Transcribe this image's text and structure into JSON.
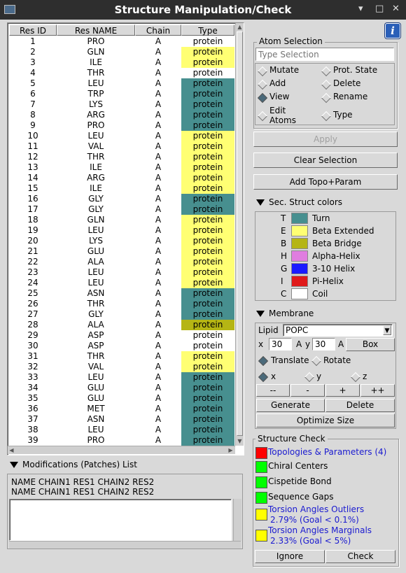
{
  "window": {
    "title": "Structure Manipulation/Check",
    "min": "▾",
    "max": "□",
    "close": "✕"
  },
  "table": {
    "headers": [
      "Res ID",
      "Res NAME",
      "Chain",
      "Type"
    ],
    "rows": [
      {
        "id": "1",
        "name": "PRO",
        "chain": "A",
        "type": "protein",
        "color": "#ffffff"
      },
      {
        "id": "2",
        "name": "GLN",
        "chain": "A",
        "type": "protein",
        "color": "#ffff73"
      },
      {
        "id": "3",
        "name": "ILE",
        "chain": "A",
        "type": "protein",
        "color": "#ffff73"
      },
      {
        "id": "4",
        "name": "THR",
        "chain": "A",
        "type": "protein",
        "color": "#ffffff"
      },
      {
        "id": "5",
        "name": "LEU",
        "chain": "A",
        "type": "protein",
        "color": "#478f8f"
      },
      {
        "id": "6",
        "name": "TRP",
        "chain": "A",
        "type": "protein",
        "color": "#478f8f"
      },
      {
        "id": "7",
        "name": "LYS",
        "chain": "A",
        "type": "protein",
        "color": "#478f8f"
      },
      {
        "id": "8",
        "name": "ARG",
        "chain": "A",
        "type": "protein",
        "color": "#478f8f"
      },
      {
        "id": "9",
        "name": "PRO",
        "chain": "A",
        "type": "protein",
        "color": "#478f8f"
      },
      {
        "id": "10",
        "name": "LEU",
        "chain": "A",
        "type": "protein",
        "color": "#ffff73"
      },
      {
        "id": "11",
        "name": "VAL",
        "chain": "A",
        "type": "protein",
        "color": "#ffff73"
      },
      {
        "id": "12",
        "name": "THR",
        "chain": "A",
        "type": "protein",
        "color": "#ffff73"
      },
      {
        "id": "13",
        "name": "ILE",
        "chain": "A",
        "type": "protein",
        "color": "#ffff73"
      },
      {
        "id": "14",
        "name": "ARG",
        "chain": "A",
        "type": "protein",
        "color": "#ffff73"
      },
      {
        "id": "15",
        "name": "ILE",
        "chain": "A",
        "type": "protein",
        "color": "#ffff73"
      },
      {
        "id": "16",
        "name": "GLY",
        "chain": "A",
        "type": "protein",
        "color": "#478f8f"
      },
      {
        "id": "17",
        "name": "GLY",
        "chain": "A",
        "type": "protein",
        "color": "#478f8f"
      },
      {
        "id": "18",
        "name": "GLN",
        "chain": "A",
        "type": "protein",
        "color": "#ffff73"
      },
      {
        "id": "19",
        "name": "LEU",
        "chain": "A",
        "type": "protein",
        "color": "#ffff73"
      },
      {
        "id": "20",
        "name": "LYS",
        "chain": "A",
        "type": "protein",
        "color": "#ffff73"
      },
      {
        "id": "21",
        "name": "GLU",
        "chain": "A",
        "type": "protein",
        "color": "#ffff73"
      },
      {
        "id": "22",
        "name": "ALA",
        "chain": "A",
        "type": "protein",
        "color": "#ffff73"
      },
      {
        "id": "23",
        "name": "LEU",
        "chain": "A",
        "type": "protein",
        "color": "#ffff73"
      },
      {
        "id": "24",
        "name": "LEU",
        "chain": "A",
        "type": "protein",
        "color": "#ffff73"
      },
      {
        "id": "25",
        "name": "ASN",
        "chain": "A",
        "type": "protein",
        "color": "#478f8f"
      },
      {
        "id": "26",
        "name": "THR",
        "chain": "A",
        "type": "protein",
        "color": "#478f8f"
      },
      {
        "id": "27",
        "name": "GLY",
        "chain": "A",
        "type": "protein",
        "color": "#478f8f"
      },
      {
        "id": "28",
        "name": "ALA",
        "chain": "A",
        "type": "protein",
        "color": "#b5b514"
      },
      {
        "id": "29",
        "name": "ASP",
        "chain": "A",
        "type": "protein",
        "color": "#ffffff"
      },
      {
        "id": "30",
        "name": "ASP",
        "chain": "A",
        "type": "protein",
        "color": "#ffffff"
      },
      {
        "id": "31",
        "name": "THR",
        "chain": "A",
        "type": "protein",
        "color": "#ffff73"
      },
      {
        "id": "32",
        "name": "VAL",
        "chain": "A",
        "type": "protein",
        "color": "#ffff73"
      },
      {
        "id": "33",
        "name": "LEU",
        "chain": "A",
        "type": "protein",
        "color": "#478f8f"
      },
      {
        "id": "34",
        "name": "GLU",
        "chain": "A",
        "type": "protein",
        "color": "#478f8f"
      },
      {
        "id": "35",
        "name": "GLU",
        "chain": "A",
        "type": "protein",
        "color": "#478f8f"
      },
      {
        "id": "36",
        "name": "MET",
        "chain": "A",
        "type": "protein",
        "color": "#478f8f"
      },
      {
        "id": "37",
        "name": "ASN",
        "chain": "A",
        "type": "protein",
        "color": "#478f8f"
      },
      {
        "id": "38",
        "name": "LEU",
        "chain": "A",
        "type": "protein",
        "color": "#478f8f"
      },
      {
        "id": "39",
        "name": "PRO",
        "chain": "A",
        "type": "protein",
        "color": "#478f8f"
      }
    ]
  },
  "modifications": {
    "title": "Modifications (Patches) List",
    "lines": [
      "NAME CHAIN1 RES1 CHAIN2 RES2",
      "NAME CHAIN1 RES1 CHAIN2 RES2"
    ]
  },
  "info_icon": "i",
  "atom_selection": {
    "title": "Atom Selection",
    "placeholder": "Type Selection",
    "modes": [
      {
        "label": "Mutate",
        "checked": false
      },
      {
        "label": "Prot. State",
        "checked": false
      },
      {
        "label": "Add",
        "checked": false
      },
      {
        "label": "Delete",
        "checked": false
      },
      {
        "label": "View",
        "checked": true
      },
      {
        "label": "Rename",
        "checked": false
      },
      {
        "label": "Edit\nAtoms",
        "checked": false
      },
      {
        "label": "Type",
        "checked": false
      }
    ]
  },
  "buttons": {
    "apply": "Apply",
    "clear": "Clear Selection",
    "add_topo": "Add Topo+Param"
  },
  "sec_struct": {
    "title": "Sec. Struct colors",
    "items": [
      {
        "code": "T",
        "label": "Turn",
        "color": "#478f8f"
      },
      {
        "code": "E",
        "label": "Beta Extended",
        "color": "#ffff73"
      },
      {
        "code": "B",
        "label": "Beta Bridge",
        "color": "#b5b514"
      },
      {
        "code": "H",
        "label": "Alpha-Helix",
        "color": "#e07de0"
      },
      {
        "code": "G",
        "label": "3-10 Helix",
        "color": "#1a1aff"
      },
      {
        "code": "I",
        "label": "Pi-Helix",
        "color": "#e01a1a"
      },
      {
        "code": "C",
        "label": "Coil",
        "color": "#ffffff"
      }
    ]
  },
  "membrane": {
    "title": "Membrane",
    "lipid_label": "Lipid",
    "lipid_value": "POPC",
    "x_label": "x",
    "x_value": "30",
    "a_label": "A",
    "y_label": "y",
    "y_value": "30",
    "a2_label": "A",
    "box_btn": "Box",
    "translate": "Translate",
    "rotate": "Rotate",
    "axes": [
      "x",
      "y",
      "z"
    ],
    "steps": [
      "--",
      "-",
      "+",
      "++"
    ],
    "generate": "Generate",
    "delete": "Delete",
    "optimize": "Optimize Size"
  },
  "structure_check": {
    "title": "Structure Check",
    "items": [
      {
        "label": "Topologies & Parameters (4)",
        "sub": "",
        "status": "#ff0000",
        "link": true
      },
      {
        "label": "Chiral Centers",
        "sub": "",
        "status": "#00ff00",
        "link": false
      },
      {
        "label": "Cispetide Bond",
        "sub": "",
        "status": "#00ff00",
        "link": false
      },
      {
        "label": "Sequence Gaps",
        "sub": "",
        "status": "#00ff00",
        "link": false
      },
      {
        "label": "Torsion Angles Outliers",
        "sub": "2.79% (Goal < 0.1%)",
        "status": "#ffff00",
        "link": true
      },
      {
        "label": "Torsion Angles Marginals",
        "sub": "2.33% (Goal < 5%)",
        "status": "#ffff00",
        "link": true
      }
    ],
    "ignore": "Ignore",
    "check": "Check"
  }
}
